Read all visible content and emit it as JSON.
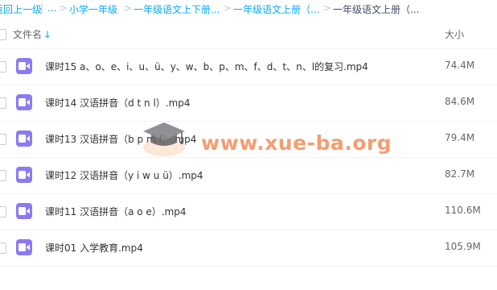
{
  "breadcrumb": {
    "items": [
      "返回上一级",
      "...",
      "小学一年级",
      "一年级语文上下册...",
      "一年级语文上册（...",
      "一年级语文上册（..."
    ],
    "separator": ">"
  },
  "table": {
    "name_header": "文件名",
    "size_header": "大小",
    "sort_icon": "arrow-down"
  },
  "files": [
    {
      "name": "课时15 a、o、e、i、u、ü、y、w、b、p、m、f、d、t、n、l的复习.mp4",
      "size": "74.4M",
      "icon": "video-icon"
    },
    {
      "name": "课时14 汉语拼音（d t n l）.mp4",
      "size": "84.6M",
      "icon": "video-icon"
    },
    {
      "name": "课时13 汉语拼音（b p m f）.mp4",
      "size": "79.4M",
      "icon": "video-icon"
    },
    {
      "name": "课时12 汉语拼音（y i w u ü）.mp4",
      "size": "82.7M",
      "icon": "video-icon"
    },
    {
      "name": "课时11 汉语拼音（a o e）.mp4",
      "size": "110.6M",
      "icon": "video-icon"
    },
    {
      "name": "课时01 入学教育.mp4",
      "size": "105.9M",
      "icon": "video-icon"
    }
  ],
  "watermark": {
    "text": "www.xue-ba.org",
    "icon": "graduation-cap-icon"
  },
  "colors": {
    "link": "#09aaff",
    "file_icon": "#8c79f3",
    "watermark": "#f48c5a"
  }
}
